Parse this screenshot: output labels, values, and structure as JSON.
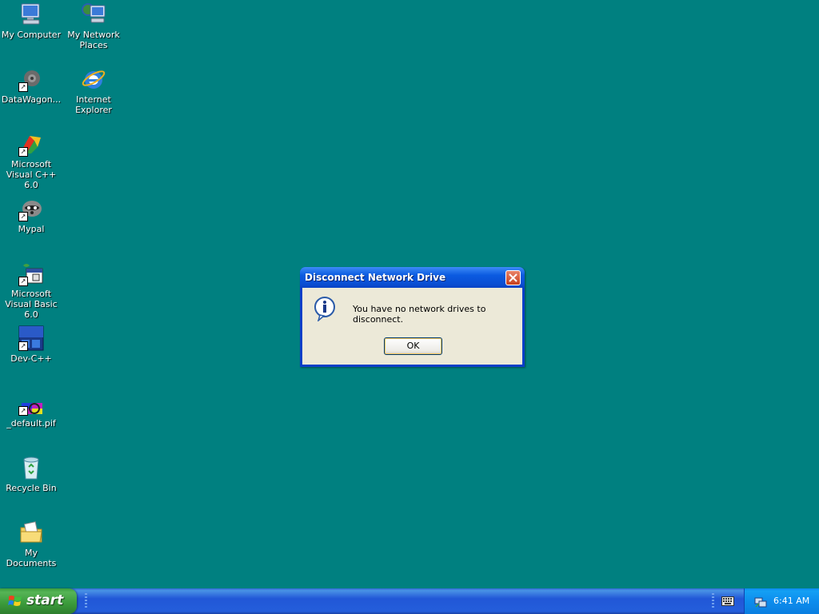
{
  "desktop": {
    "background_color": "#008080",
    "icons": [
      {
        "label": "My Computer",
        "icon": "my-computer-icon"
      },
      {
        "label": "My Network Places",
        "icon": "network-places-icon"
      },
      {
        "label": "DataWagon...",
        "icon": "datawagon-icon"
      },
      {
        "label": "Internet Explorer",
        "icon": "internet-explorer-icon"
      },
      {
        "label": "Microsoft Visual C++ 6.0",
        "icon": "visual-cpp-icon"
      },
      {
        "label": "Mypal",
        "icon": "mypal-icon"
      },
      {
        "label": "Microsoft Visual Basic 6.0",
        "icon": "visual-basic-icon"
      },
      {
        "label": "Dev-C++",
        "icon": "dev-cpp-icon"
      },
      {
        "label": "_default.pif",
        "icon": "ms-dos-pif-icon"
      },
      {
        "label": "Recycle Bin",
        "icon": "recycle-bin-icon"
      },
      {
        "label": "My Documents",
        "icon": "my-documents-icon"
      }
    ]
  },
  "dialog": {
    "title": "Disconnect Network Drive",
    "message": "You have no network drives to disconnect.",
    "ok_label": "OK",
    "icon": "information-icon"
  },
  "taskbar": {
    "start_label": "start",
    "clock": "6:41 AM",
    "accent": "#245edb",
    "start_color": "#3a9a3a"
  }
}
